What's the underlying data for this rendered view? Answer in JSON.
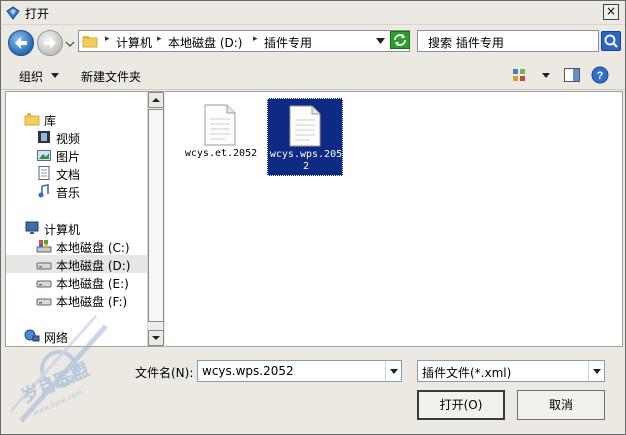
{
  "window": {
    "title": "打开",
    "close_glyph": "×"
  },
  "address": {
    "crumbs": [
      "计算机",
      "本地磁盘 (D:)",
      "插件专用"
    ],
    "separator": "▸",
    "search_placeholder": "搜索 插件专用"
  },
  "toolbar": {
    "organize": "组织",
    "new_folder": "新建文件夹"
  },
  "nav": {
    "favorites_header": "库",
    "library_items": [
      "视频",
      "图片",
      "文档",
      "音乐"
    ],
    "computer_header": "计算机",
    "drives": [
      "本地磁盘 (C:)",
      "本地磁盘 (D:)",
      "本地磁盘 (E:)",
      "本地磁盘 (F:)"
    ],
    "selected_drive": "本地磁盘 (D:)",
    "network": "网络"
  },
  "files": [
    {
      "name": "wcys.et.2052",
      "selected": false
    },
    {
      "name": "wcys.wps.2052",
      "selected": true
    }
  ],
  "bottom": {
    "filename_label": "文件名(N):",
    "filename_value": "wcys.wps.2052",
    "filetype_value": "插件文件(*.xml)",
    "open_label": "打开(O)",
    "cancel_label": "取消"
  },
  "watermark": {
    "text": "岁月联盟",
    "url": "www.5yue.com"
  },
  "colors": {
    "selection": "#0f2a82",
    "accent": "#2368b4",
    "refresh": "#2e9d2e"
  }
}
